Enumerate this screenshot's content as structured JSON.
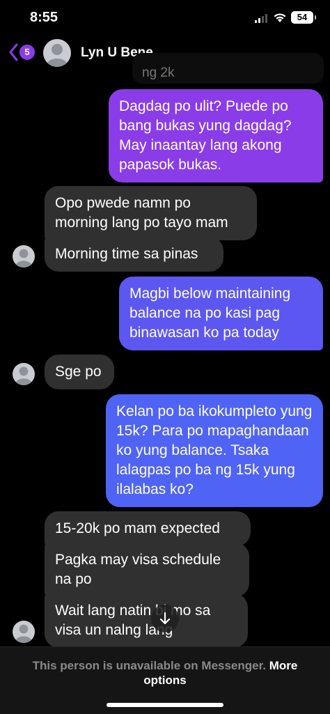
{
  "status_bar": {
    "time": "8:55",
    "battery": "54"
  },
  "header": {
    "unread_count": "5",
    "contact_name": "Lyn U Bene"
  },
  "quoted_fragment": "ng 2k",
  "messages": [
    {
      "side": "out",
      "text": "Dagdag po ulit? Puede po bang bukas yung dagdag? May inaantay lang akong papasok bukas."
    },
    {
      "side": "in",
      "text": "Opo pwede namn po morning lang po tayo mam"
    },
    {
      "side": "in",
      "text": "Morning time sa pinas"
    },
    {
      "side": "out",
      "text": "Magbi below maintaining balance na po kasi pag binawasan ko pa today"
    },
    {
      "side": "in",
      "text": "Sge po"
    },
    {
      "side": "out",
      "text": "Kelan po ba ikokumpleto yung 15k? Para po mapaghandaan ko yung balance. Tsaka lalagpas po ba ng 15k yung ilalabas ko?"
    },
    {
      "side": "in",
      "text": "15-20k po mam expected"
    },
    {
      "side": "in",
      "text": "Pagka may visa schedule na po"
    },
    {
      "side": "in",
      "text": "Wait lang natin bi mo sa visa un nalng  lang"
    }
  ],
  "footer": {
    "notice": "This person is unavailable on Messenger.",
    "link": "More options"
  },
  "colors": {
    "incoming": "#303030",
    "outgoing_top": "#8a3ce8",
    "outgoing_bottom": "#4f63f5",
    "accent": "#8a3ce8"
  },
  "icons": [
    "back-chevron-icon",
    "wifi-icon",
    "signal-icon",
    "battery-icon",
    "scroll-down-arrow-icon",
    "avatar-icon"
  ]
}
